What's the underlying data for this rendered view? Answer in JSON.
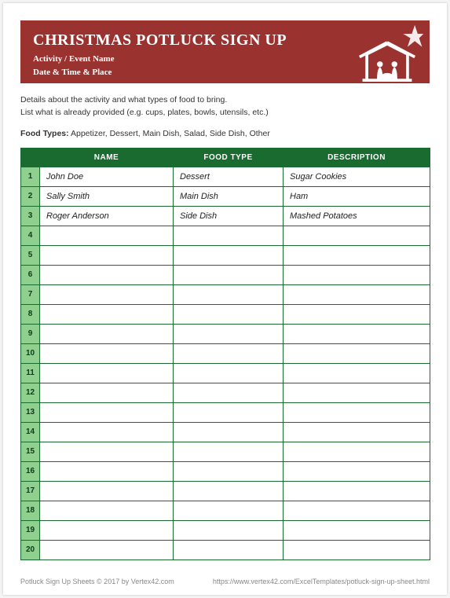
{
  "header": {
    "title": "CHRISTMAS POTLUCK SIGN UP",
    "activity_label": "Activity / Event Name",
    "datetime_label": "Date & Time & Place"
  },
  "intro": {
    "line1": "Details about the activity and what types of food to bring.",
    "line2": "List what is already provided (e.g. cups, plates, bowls, utensils, etc.)"
  },
  "food_types": {
    "label": "Food Types:",
    "list": "Appetizer, Dessert, Main Dish, Salad, Side Dish, Other"
  },
  "table": {
    "headers": {
      "name": "NAME",
      "type": "FOOD TYPE",
      "desc": "DESCRIPTION"
    },
    "rows": [
      {
        "n": "1",
        "name": "John Doe",
        "type": "Dessert",
        "desc": "Sugar Cookies"
      },
      {
        "n": "2",
        "name": "Sally Smith",
        "type": "Main Dish",
        "desc": "Ham"
      },
      {
        "n": "3",
        "name": "Roger Anderson",
        "type": "Side Dish",
        "desc": "Mashed Potatoes"
      },
      {
        "n": "4",
        "name": "",
        "type": "",
        "desc": ""
      },
      {
        "n": "5",
        "name": "",
        "type": "",
        "desc": ""
      },
      {
        "n": "6",
        "name": "",
        "type": "",
        "desc": ""
      },
      {
        "n": "7",
        "name": "",
        "type": "",
        "desc": ""
      },
      {
        "n": "8",
        "name": "",
        "type": "",
        "desc": ""
      },
      {
        "n": "9",
        "name": "",
        "type": "",
        "desc": ""
      },
      {
        "n": "10",
        "name": "",
        "type": "",
        "desc": ""
      },
      {
        "n": "11",
        "name": "",
        "type": "",
        "desc": ""
      },
      {
        "n": "12",
        "name": "",
        "type": "",
        "desc": ""
      },
      {
        "n": "13",
        "name": "",
        "type": "",
        "desc": ""
      },
      {
        "n": "14",
        "name": "",
        "type": "",
        "desc": ""
      },
      {
        "n": "15",
        "name": "",
        "type": "",
        "desc": ""
      },
      {
        "n": "16",
        "name": "",
        "type": "",
        "desc": ""
      },
      {
        "n": "17",
        "name": "",
        "type": "",
        "desc": ""
      },
      {
        "n": "18",
        "name": "",
        "type": "",
        "desc": ""
      },
      {
        "n": "19",
        "name": "",
        "type": "",
        "desc": ""
      },
      {
        "n": "20",
        "name": "",
        "type": "",
        "desc": ""
      }
    ]
  },
  "footer": {
    "left": "Potluck Sign Up Sheets © 2017 by Vertex42.com",
    "right": "https://www.vertex42.com/ExcelTemplates/potluck-sign-up-sheet.html"
  }
}
